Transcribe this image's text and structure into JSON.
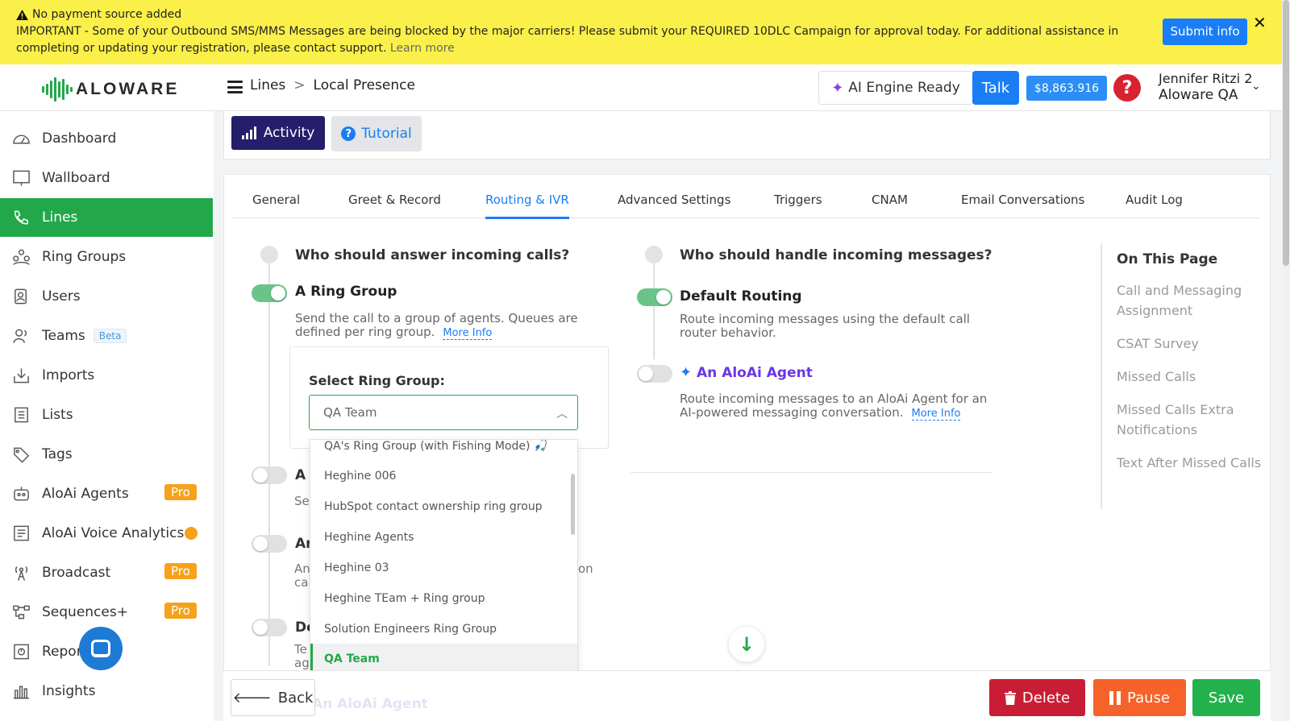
{
  "banner": {
    "warning_title": "No payment source added",
    "message": "IMPORTANT - Some of your Outbound SMS/MMS Messages are being blocked by the major carriers! Please submit your REQUIRED 10DLC Campaign for approval today. For additional assistance in completing or updating your registration, please contact support.",
    "learn_more": "Learn more",
    "submit_label": "Submit info",
    "close_label": "✕"
  },
  "header": {
    "logo_text": "ALOWARE",
    "breadcrumb": [
      "Lines",
      ">",
      "Local Presence"
    ],
    "ai_engine": "AI Engine Ready",
    "talk": "Talk",
    "balance": "$8,863.916",
    "help": "?",
    "user_name": "Jennifer Ritzi 2",
    "company": "Aloware QA"
  },
  "sidebar": {
    "items": [
      {
        "label": "Dashboard",
        "icon": "dashboard-icon"
      },
      {
        "label": "Wallboard",
        "icon": "wallboard-icon"
      },
      {
        "label": "Lines",
        "icon": "phone-icon"
      },
      {
        "label": "Ring Groups",
        "icon": "ring-groups-icon"
      },
      {
        "label": "Users",
        "icon": "users-icon"
      },
      {
        "label": "Teams",
        "icon": "teams-icon",
        "badge": "Beta"
      },
      {
        "label": "Imports",
        "icon": "imports-icon"
      },
      {
        "label": "Lists",
        "icon": "lists-icon"
      },
      {
        "label": "Tags",
        "icon": "tags-icon"
      },
      {
        "label": "AloAi Agents",
        "icon": "aloai-agents-icon",
        "badge": "Pro"
      },
      {
        "label": "AloAi Voice Analytics",
        "icon": "voice-analytics-icon"
      },
      {
        "label": "Broadcast",
        "icon": "broadcast-icon",
        "badge": "Pro"
      },
      {
        "label": "Sequences+",
        "icon": "sequences-icon",
        "badge": "Pro"
      },
      {
        "label": "Reports",
        "icon": "reports-icon"
      },
      {
        "label": "Insights",
        "icon": "insights-icon"
      }
    ],
    "active": "Lines"
  },
  "toolbar": {
    "activity": "Activity",
    "tutorial": "Tutorial"
  },
  "tabs": [
    "General",
    "Greet & Record",
    "Routing & IVR",
    "Advanced Settings",
    "Triggers",
    "CNAM",
    "Email Conversations",
    "Audit Log"
  ],
  "active_tab": "Routing & IVR",
  "calls": {
    "heading": "Who should answer incoming calls?",
    "option_title": "A Ring Group",
    "option_desc": "Send the call to a group of agents. Queues are defined per ring group.",
    "more_info": "More Info",
    "select_label": "Select Ring Group:",
    "selected_value": "QA Team",
    "partial_a": "A",
    "partial_a_desc": "Se",
    "partial_an": "An",
    "partial_an_desc_1": "An",
    "partial_an_desc_2": "cal",
    "partial_an_desc_tail": "on",
    "partial_de": "De",
    "partial_de_desc_1": "Te",
    "partial_de_desc_2": "ag"
  },
  "dropdown": {
    "options": [
      "QA's Ring Group (with Fishing Mode) 🎣",
      "Heghine 006",
      "HubSpot contact ownership ring group",
      "Heghine Agents",
      "Heghine 03",
      "Heghine TEam + Ring group",
      "Solution Engineers Ring Group",
      "QA Team"
    ],
    "selected": "QA Team"
  },
  "messages": {
    "heading": "Who should handle incoming messages?",
    "default_title": "Default Routing",
    "default_desc": "Route incoming messages using the default call router behavior.",
    "agent_title": "An AloAi Agent",
    "agent_desc": "Route incoming messages to an AloAi Agent for an AI-powered messaging conversation.",
    "more_info": "More Info"
  },
  "on_this_page": {
    "title": "On This Page",
    "links": [
      "Call and Messaging Assignment",
      "CSAT Survey",
      "Missed Calls",
      "Missed Calls Extra Notifications",
      "Text After Missed Calls"
    ]
  },
  "footer": {
    "back": "Back",
    "ghost_text": "An AloAi Agent",
    "delete": "Delete",
    "pause": "Pause",
    "save": "Save"
  },
  "colors": {
    "banner": "#fbf04a",
    "brand_green": "#22a84a",
    "primary_blue": "#1a7df5",
    "activity_navy": "#241e6b",
    "delete_red": "#c81d34",
    "pause_orange": "#f6622a",
    "pro_badge": "#f6a21a"
  }
}
